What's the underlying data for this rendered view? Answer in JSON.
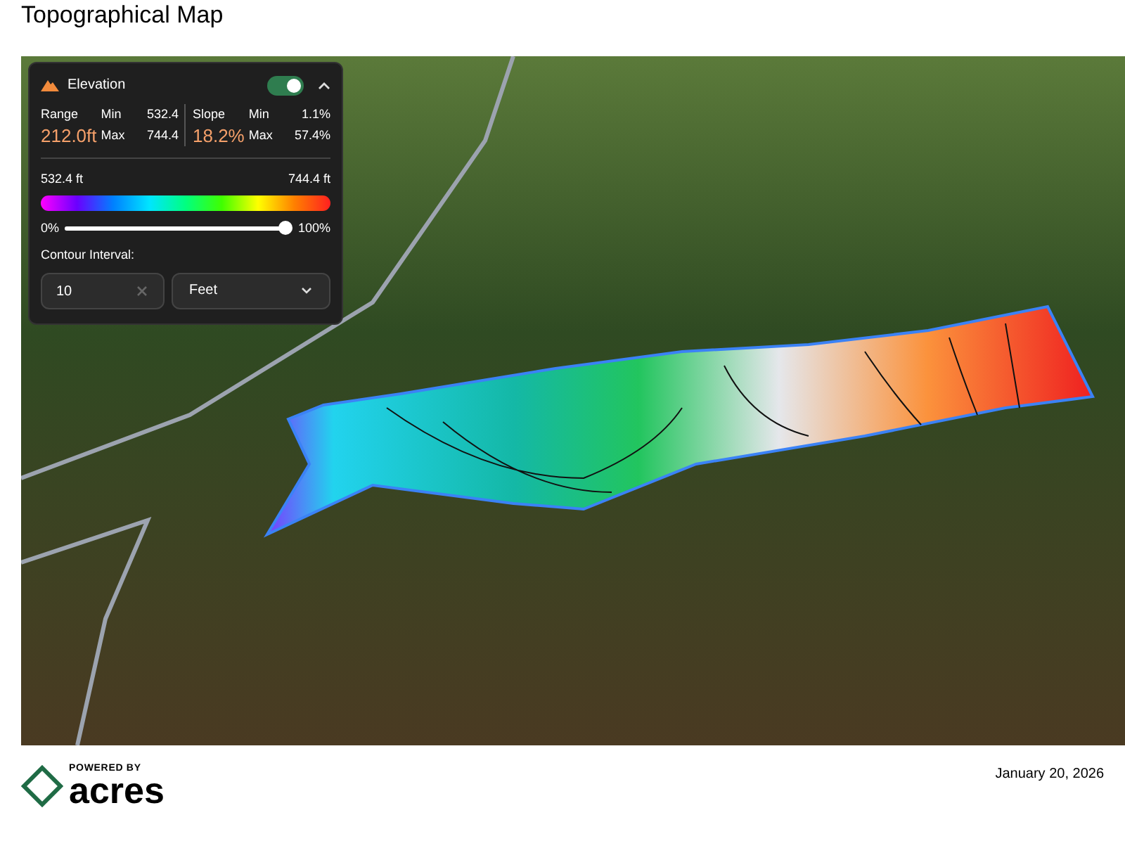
{
  "page_title": "Topographical Map",
  "panel": {
    "title": "Elevation",
    "toggle_on": true,
    "expanded": true,
    "range": {
      "label": "Range",
      "value": "212.0ft",
      "min_label": "Min",
      "min": "532.4",
      "max_label": "Max",
      "max": "744.4"
    },
    "slope": {
      "label": "Slope",
      "value": "18.2%",
      "min_label": "Min",
      "min": "1.1%",
      "max_label": "Max",
      "max": "57.4%"
    },
    "scale_low": "532.4 ft",
    "scale_high": "744.4 ft",
    "opacity": {
      "low_label": "0%",
      "high_label": "100%",
      "level": 1
    },
    "contour_label": "Contour Interval:",
    "contour_value": "10",
    "unit": "Feet"
  },
  "footer": {
    "powered_by": "POWERED BY",
    "brand": "acres",
    "date": "January 20, 2026"
  }
}
